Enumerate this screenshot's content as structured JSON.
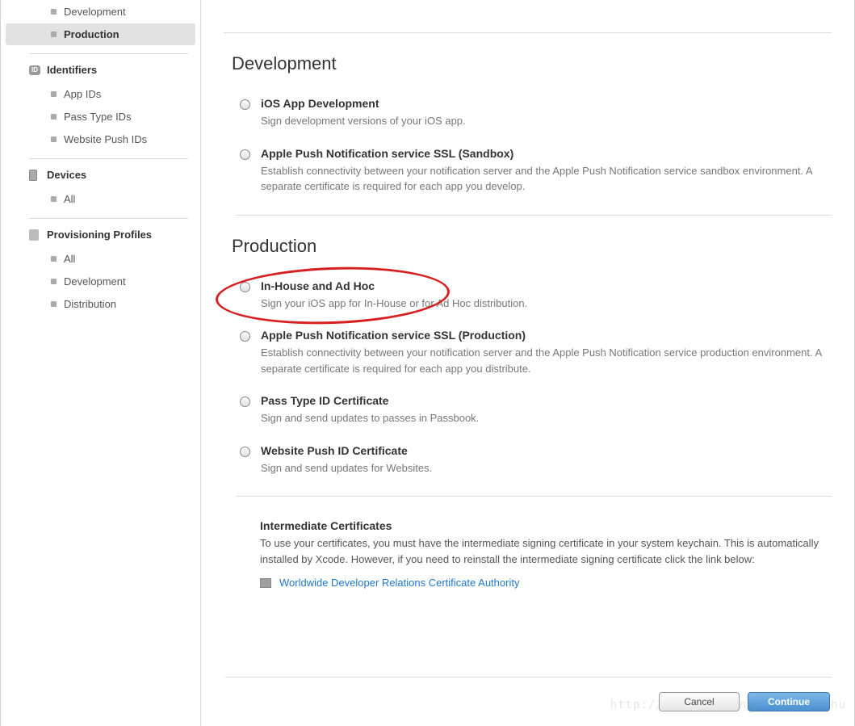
{
  "sidebar": {
    "certificates": {
      "items": [
        {
          "label": "Development"
        },
        {
          "label": "Production"
        }
      ]
    },
    "identifiers": {
      "title": "Identifiers",
      "items": [
        {
          "label": "App IDs"
        },
        {
          "label": "Pass Type IDs"
        },
        {
          "label": "Website Push IDs"
        }
      ]
    },
    "devices": {
      "title": "Devices",
      "items": [
        {
          "label": "All"
        }
      ]
    },
    "profiles": {
      "title": "Provisioning Profiles",
      "items": [
        {
          "label": "All"
        },
        {
          "label": "Development"
        },
        {
          "label": "Distribution"
        }
      ]
    }
  },
  "main": {
    "development": {
      "title": "Development",
      "options": [
        {
          "title": "iOS App Development",
          "desc": "Sign development versions of your iOS app."
        },
        {
          "title": "Apple Push Notification service SSL (Sandbox)",
          "desc": "Establish connectivity between your notification server and the Apple Push Notification service sandbox environment. A separate certificate is required for each app you develop."
        }
      ]
    },
    "production": {
      "title": "Production",
      "options": [
        {
          "title": "In-House and Ad Hoc",
          "desc": "Sign your iOS app for In-House or for Ad Hoc distribution."
        },
        {
          "title": "Apple Push Notification service SSL (Production)",
          "desc": "Establish connectivity between your notification server and the Apple Push Notification service production environment. A separate certificate is required for each app you distribute."
        },
        {
          "title": "Pass Type ID Certificate",
          "desc": "Sign and send updates to passes in Passbook."
        },
        {
          "title": "Website Push ID Certificate",
          "desc": "Sign and send updates for Websites."
        }
      ]
    },
    "intermediate": {
      "title": "Intermediate Certificates",
      "text": "To use your certificates, you must have the intermediate signing certificate in your system keychain. This is automatically installed by Xcode. However, if you need to reinstall the intermediate signing certificate click the link below:",
      "link": "Worldwide Developer Relations Certificate Authority"
    }
  },
  "buttons": {
    "cancel": "Cancel",
    "continue": "Continue"
  },
  "watermark": "http://blog.csdn.net/zhaoxy_thu"
}
